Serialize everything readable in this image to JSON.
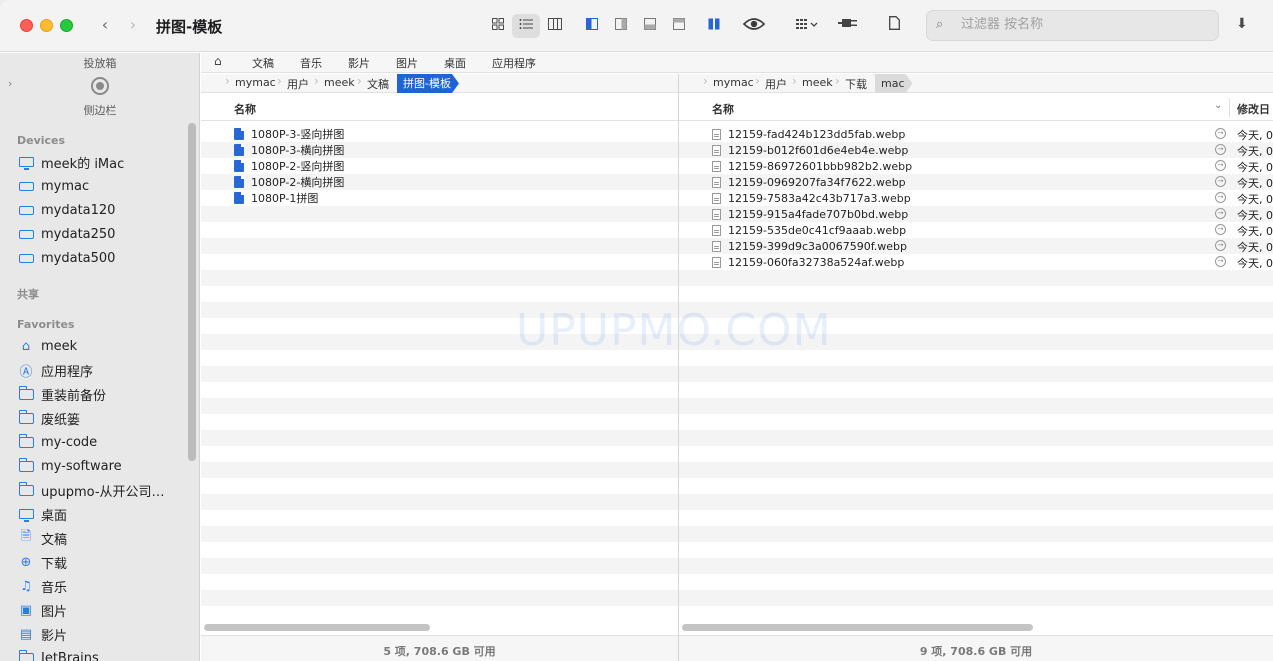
{
  "window": {
    "title": "拼图-模板"
  },
  "toolbar": {
    "search_placeholder": "过滤器 按名称"
  },
  "sidebar": {
    "dropbox_label": "投放箱",
    "sidebar_label": "侧边栏",
    "devices_header": "Devices",
    "devices": [
      "meek的 iMac",
      "mymac",
      "mydata120",
      "mydata250",
      "mydata500"
    ],
    "shared_header": "共享",
    "favorites_header": "Favorites",
    "favorites": [
      "meek",
      "应用程序",
      "重装前备份",
      "废纸篓",
      "my-code",
      "my-software",
      "upupmo-从开公司…",
      "桌面",
      "文稿",
      "下载",
      "音乐",
      "图片",
      "影片",
      "JetBrains"
    ]
  },
  "favbar": [
    "文稿",
    "音乐",
    "影片",
    "图片",
    "桌面",
    "应用程序"
  ],
  "left_pane": {
    "crumbs": [
      "mymac",
      "用户",
      "meek",
      "文稿"
    ],
    "active_crumb": "拼图-模板",
    "col_name": "名称",
    "files": [
      "1080P-3-竖向拼图",
      "1080P-3-横向拼图",
      "1080P-2-竖向拼图",
      "1080P-2-横向拼图",
      "1080P-1拼图"
    ],
    "status": "5 项, 708.6 GB 可用"
  },
  "right_pane": {
    "crumbs": [
      "mymac",
      "用户",
      "meek",
      "下载"
    ],
    "active_crumb": "mac",
    "col_name": "名称",
    "col_date": "修改日",
    "files": [
      {
        "name": "12159-fad424b123dd5fab.webp",
        "date": "今天, 0"
      },
      {
        "name": "12159-b012f601d6e4eb4e.webp",
        "date": "今天, 0"
      },
      {
        "name": "12159-86972601bbb982b2.webp",
        "date": "今天, 0"
      },
      {
        "name": "12159-0969207fa34f7622.webp",
        "date": "今天, 0"
      },
      {
        "name": "12159-7583a42c43b717a3.webp",
        "date": "今天, 0"
      },
      {
        "name": "12159-915a4fade707b0bd.webp",
        "date": "今天, 0"
      },
      {
        "name": "12159-535de0c41cf9aaab.webp",
        "date": "今天, 0"
      },
      {
        "name": "12159-399d9c3a0067590f.webp",
        "date": "今天, 0"
      },
      {
        "name": "12159-060fa32738a524af.webp",
        "date": "今天, 0"
      }
    ],
    "status": "9 项, 708.6 GB 可用"
  },
  "watermark": "UPUPMO.COM"
}
